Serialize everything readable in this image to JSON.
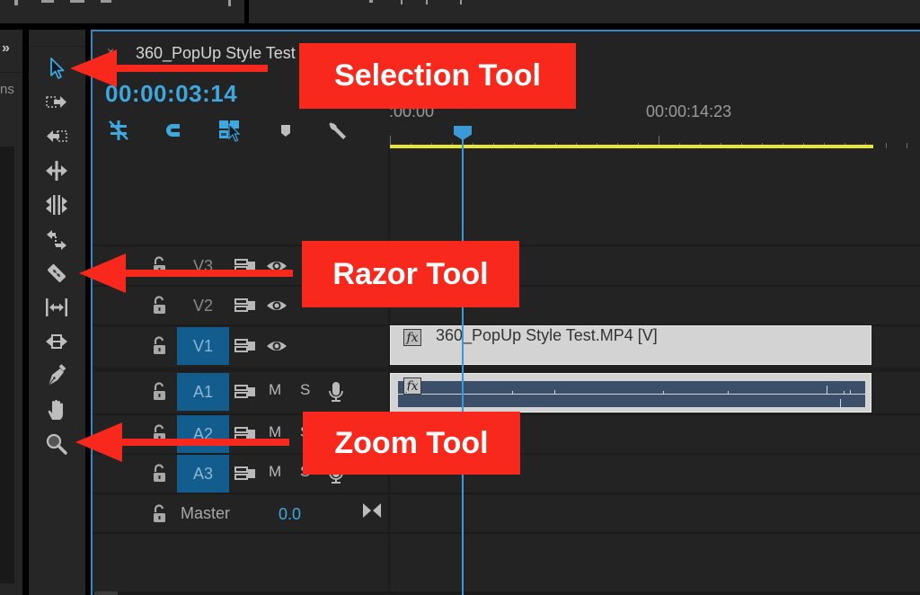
{
  "sequence": {
    "title": "360_PopUp Style Test",
    "timecode": "00:00:03:14",
    "ruler_labels": [
      ":00:00",
      "00:00:14:23"
    ],
    "playhead_position_fraction": 0.125
  },
  "left_panel": {
    "expand_glyph": "»",
    "truncated_label": "ns"
  },
  "tools": [
    {
      "name": "selection-tool",
      "icon": "arrow-cursor-icon",
      "active": true
    },
    {
      "name": "track-select-forward-tool",
      "icon": "track-forward-icon",
      "active": false
    },
    {
      "name": "track-select-backward-tool",
      "icon": "track-backward-icon",
      "active": false
    },
    {
      "name": "ripple-edit-tool",
      "icon": "ripple-edit-icon",
      "active": false
    },
    {
      "name": "rolling-edit-tool",
      "icon": "rolling-edit-icon",
      "active": false
    },
    {
      "name": "rate-stretch-tool",
      "icon": "rate-stretch-icon",
      "active": false
    },
    {
      "name": "razor-tool",
      "icon": "razor-blade-icon",
      "active": false
    },
    {
      "name": "slip-tool",
      "icon": "slip-icon",
      "active": false
    },
    {
      "name": "slide-tool",
      "icon": "slide-icon",
      "active": false
    },
    {
      "name": "pen-tool",
      "icon": "pen-icon",
      "active": false
    },
    {
      "name": "hand-tool",
      "icon": "hand-icon",
      "active": false
    },
    {
      "name": "zoom-tool",
      "icon": "magnifier-icon",
      "active": false
    }
  ],
  "timeline_toolbar": [
    {
      "name": "insert-nest-toggle",
      "icon": "nest-icon"
    },
    {
      "name": "snap-toggle",
      "icon": "magnet-icon"
    },
    {
      "name": "linked-selection-toggle",
      "icon": "linked-selection-icon"
    },
    {
      "name": "add-marker",
      "icon": "marker-icon"
    },
    {
      "name": "timeline-settings",
      "icon": "wrench-icon"
    }
  ],
  "tracks": {
    "video": [
      {
        "label": "V3",
        "targeted": false
      },
      {
        "label": "V2",
        "targeted": false
      },
      {
        "label": "V1",
        "targeted": true
      }
    ],
    "audio": [
      {
        "label": "A1",
        "targeted": true,
        "mute": "M",
        "solo": "S"
      },
      {
        "label": "A2",
        "targeted": true,
        "mute": "M",
        "solo": "S"
      },
      {
        "label": "A3",
        "targeted": true,
        "mute": "M",
        "solo": "S"
      }
    ],
    "master": {
      "label": "Master",
      "value": "0.0"
    }
  },
  "clips": {
    "video": {
      "name": "360_PopUp Style Test.MP4 [V]",
      "fx_label": "fx"
    },
    "audio": {
      "fx_label": "fx"
    }
  },
  "callouts": [
    {
      "text": "Selection Tool",
      "color": "#f8281c"
    },
    {
      "text": "Razor Tool",
      "color": "#f8281c"
    },
    {
      "text": "Zoom Tool",
      "color": "#f8281c"
    }
  ],
  "colors": {
    "accent_blue": "#3ea7de",
    "work_area_bar": "#e8e335",
    "track_target": "#135d8e",
    "callout_red": "#f8281c"
  }
}
